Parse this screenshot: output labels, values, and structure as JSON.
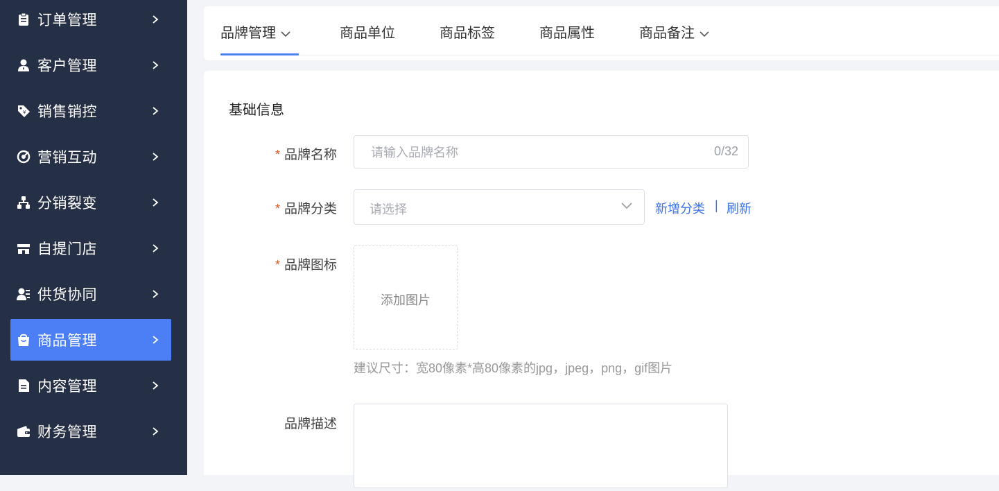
{
  "colors": {
    "sidebar_bg": "#252f45",
    "accent": "#4c7ef5",
    "link": "#3f72e6",
    "required": "#e0561f"
  },
  "sidebar": {
    "items": [
      {
        "label": "订单管理",
        "icon": "clipboard-icon",
        "active": false
      },
      {
        "label": "客户管理",
        "icon": "user-icon",
        "active": false
      },
      {
        "label": "销售销控",
        "icon": "price-tag-icon",
        "active": false
      },
      {
        "label": "营销互动",
        "icon": "target-icon",
        "active": false
      },
      {
        "label": "分销裂变",
        "icon": "hierarchy-icon",
        "active": false
      },
      {
        "label": "自提门店",
        "icon": "store-icon",
        "active": false
      },
      {
        "label": "供货协同",
        "icon": "supplier-icon",
        "active": false
      },
      {
        "label": "商品管理",
        "icon": "shopping-bag-icon",
        "active": true
      },
      {
        "label": "内容管理",
        "icon": "document-icon",
        "active": false
      },
      {
        "label": "财务管理",
        "icon": "wallet-icon",
        "active": false
      }
    ]
  },
  "tabs": [
    {
      "label": "品牌管理",
      "has_dropdown": true,
      "active": true
    },
    {
      "label": "商品单位",
      "has_dropdown": false,
      "active": false
    },
    {
      "label": "商品标签",
      "has_dropdown": false,
      "active": false
    },
    {
      "label": "商品属性",
      "has_dropdown": false,
      "active": false
    },
    {
      "label": "商品备注",
      "has_dropdown": true,
      "active": false
    }
  ],
  "form": {
    "section_title": "基础信息",
    "brand_name": {
      "required_mark": "*",
      "label": "品牌名称",
      "placeholder": "请输入品牌名称",
      "value": "",
      "counter": "0/32"
    },
    "brand_category": {
      "required_mark": "*",
      "label": "品牌分类",
      "placeholder": "请选择",
      "add_link": "新增分类",
      "separator": "|",
      "refresh_link": "刷新"
    },
    "brand_icon": {
      "required_mark": "*",
      "label": "品牌图标",
      "upload_text": "添加图片",
      "hint": "建议尺寸：宽80像素*高80像素的jpg，jpeg，png，gif图片"
    },
    "brand_desc": {
      "label": "品牌描述",
      "value": ""
    }
  }
}
